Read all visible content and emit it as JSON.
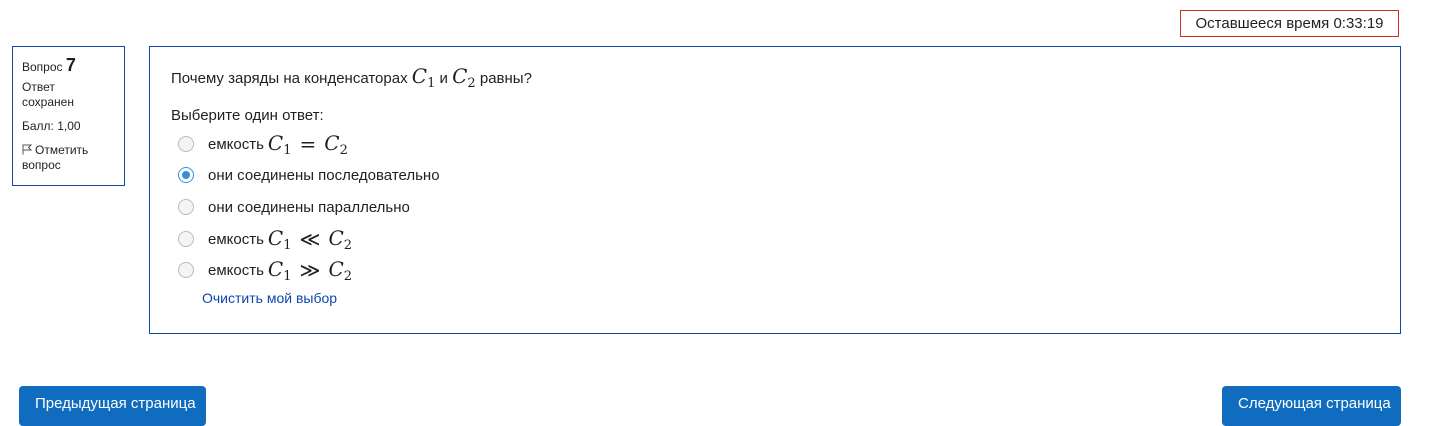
{
  "timer": {
    "label": "Оставшееся время",
    "value": "0:33:19"
  },
  "info": {
    "question_label": "Вопрос",
    "question_number": "7",
    "state": "Ответ сохранен",
    "grade": "Балл: 1,00",
    "flag_label": "Отметить вопрос"
  },
  "question": {
    "text_before": "Почему заряды на конденсаторах",
    "text_and": "и",
    "text_after": "равны?",
    "c_symbol": "C",
    "c1_sub": "1",
    "c2_sub": "2",
    "prompt": "Выберите один ответ:",
    "options": [
      {
        "label": "емкость",
        "math_op": "=",
        "selected": false
      },
      {
        "label": "они соединены последовательно",
        "selected": true
      },
      {
        "label": "они соединены параллельно",
        "selected": false
      },
      {
        "label": "емкость",
        "math_op": "≪",
        "selected": false
      },
      {
        "label": "емкость",
        "math_op": "≫",
        "selected": false
      }
    ],
    "clear_label": "Очистить мой выбор"
  },
  "nav": {
    "prev_label": "Предыдущая страница",
    "next_label": "Следующая страница"
  },
  "colors": {
    "accent": "#0f6cbf",
    "border": "#0f47ad",
    "timer_border": "#ca3120",
    "radio_checked": "#3a8ed8"
  }
}
